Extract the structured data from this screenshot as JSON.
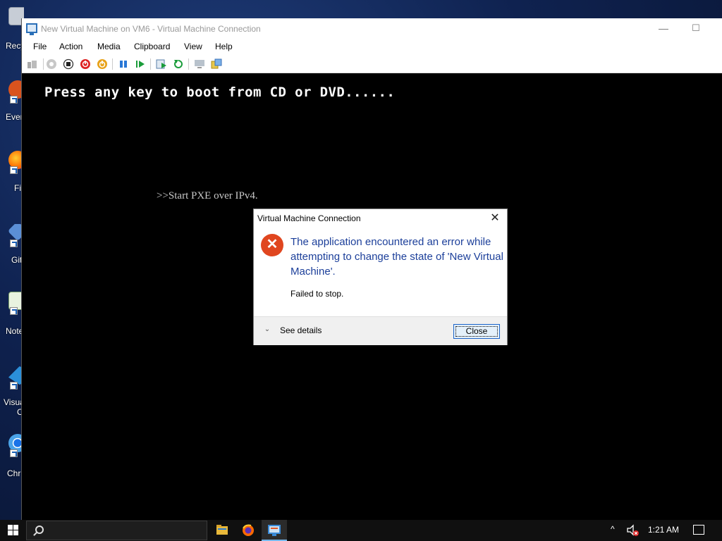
{
  "desktop": {
    "icons": [
      {
        "label": "Recy",
        "icon": "recycle-bin-icon"
      },
      {
        "label": "Ever",
        "icon": "app-shortcut-icon"
      },
      {
        "label": "Fi",
        "icon": "firefox-icon"
      },
      {
        "label": "Git",
        "icon": "git-icon"
      },
      {
        "label": "Note",
        "icon": "notepad-icon"
      },
      {
        "label": "Visua",
        "icon": "vscode-icon"
      },
      {
        "label": "Chr",
        "icon": "chrome-icon"
      }
    ],
    "icons_extra": {
      "visual_line2": "C"
    }
  },
  "window": {
    "title": "New Virtual Machine on VM6 - Virtual Machine Connection",
    "minimize_glyph": "—",
    "maximize_glyph": "☐",
    "menu": [
      "File",
      "Action",
      "Media",
      "Clipboard",
      "View",
      "Help"
    ]
  },
  "toolbar": {
    "tools": [
      "ctrl-alt-del-icon",
      "start-icon",
      "turn-off-icon",
      "shutdown-icon",
      "power-icon",
      "pause-icon",
      "resume-icon",
      "checkpoint-icon",
      "revert-icon",
      "enhanced-session-icon",
      "share-icon"
    ]
  },
  "vm_screen": {
    "boot_message": "Press any key to boot from CD or DVD......",
    "pxe_message": ">>Start PXE over IPv4."
  },
  "dialog": {
    "title": "Virtual Machine Connection",
    "close_x": "✕",
    "error_glyph": "✕",
    "main_instruction": "The application encountered an error while attempting to change the state of 'New Virtual Machine'.",
    "content": "Failed to stop.",
    "see_details": "See details",
    "chevron": "⌄",
    "close_button": "Close"
  },
  "taskbar": {
    "clock": "1:21 AM",
    "tray_chevron": "^",
    "apps": [
      "file-explorer-icon",
      "firefox-icon",
      "vm-connection-icon"
    ]
  },
  "colors": {
    "dialog_instruction": "#1c3f9a",
    "error_icon": "#e0461f",
    "taskbar": "#101010"
  }
}
